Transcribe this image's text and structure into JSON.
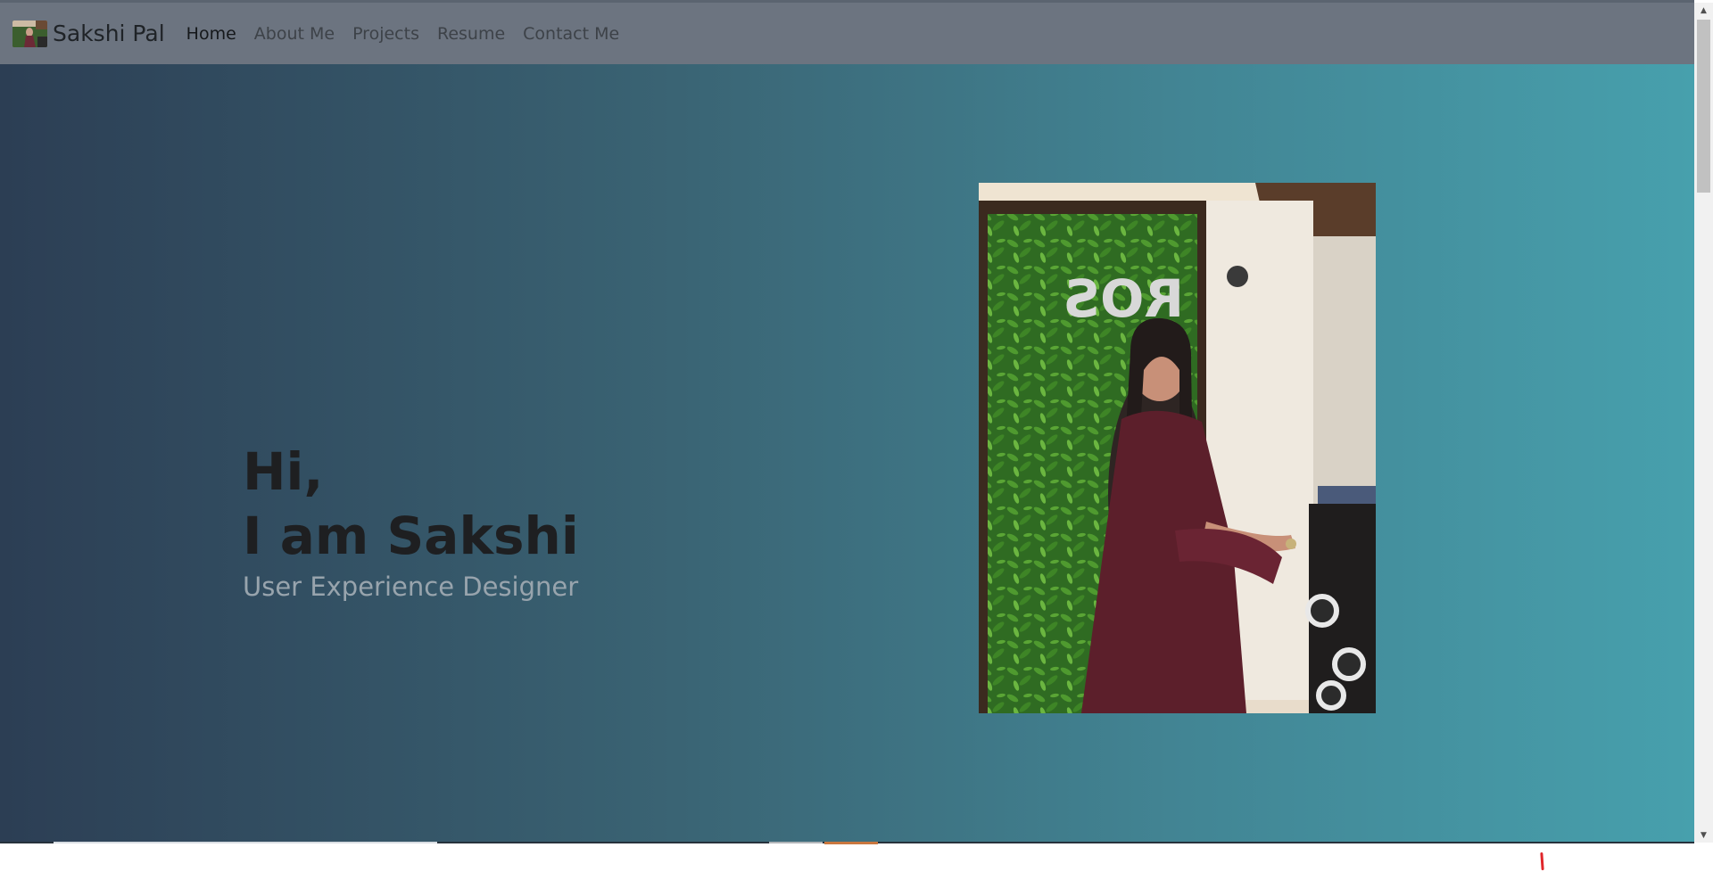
{
  "brand": {
    "name": "Sakshi Pal"
  },
  "nav": {
    "items": [
      {
        "label": "Home",
        "active": true
      },
      {
        "label": "About Me",
        "active": false
      },
      {
        "label": "Projects",
        "active": false
      },
      {
        "label": "Resume",
        "active": false
      },
      {
        "label": "Contact Me",
        "active": false
      }
    ]
  },
  "hero": {
    "line1": "Hi,",
    "line2": "I am Sakshi",
    "role": "User Experience Designer"
  },
  "colors": {
    "navbar": "#6c7480",
    "gradient_start": "#2c3e54",
    "gradient_end": "#47a0ad",
    "heading": "#1e1f21",
    "subtitle": "#98a4ad"
  },
  "icons": {
    "scroll_up": "up-arrow-icon",
    "scroll_down": "down-arrow-icon"
  }
}
